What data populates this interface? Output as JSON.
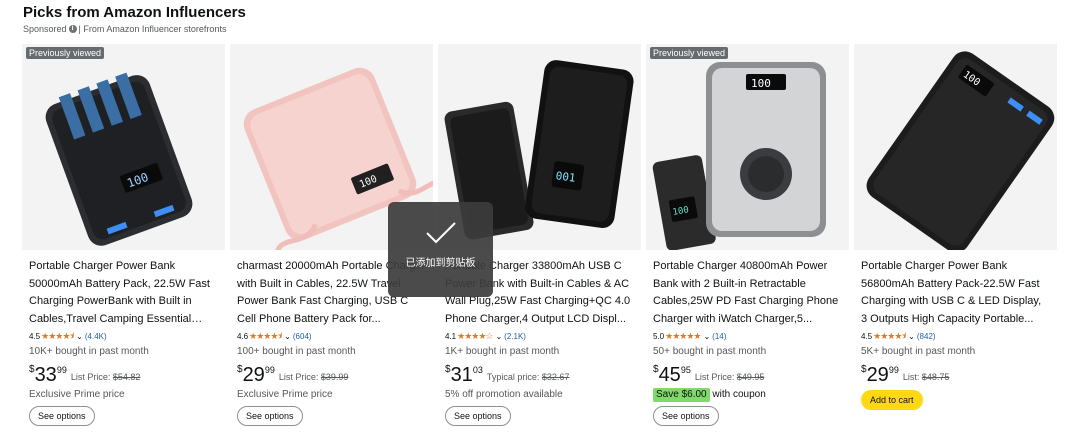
{
  "header": {
    "title": "Picks from Amazon Influencers",
    "sponsored": "Sponsored",
    "info_icon": "i",
    "source": "| From Amazon Influencer storefronts"
  },
  "products": [
    {
      "badge": "Previously viewed",
      "title": "Portable Charger Power Bank 50000mAh Battery Pack, 22.5W Fast Charging PowerBank with Built in Cables,Travel Camping Essential US...",
      "rating": "4.5",
      "stars": "★★★★⯨",
      "reviews": "(4.4K)",
      "bought": "10K+ bought in past month",
      "price_currency": "$",
      "price_whole": "33",
      "price_fraction": "99",
      "list_label": "List Price:",
      "list_price": "$54.82",
      "extra": "Exclusive Prime price",
      "button": "See options",
      "image_type": "black-powerbank-cables"
    },
    {
      "badge": "",
      "title": "charmast 20000mAh Portable Charger with Built in Cables, 22.5W Travel Power Bank Fast Charging, USB C Cell Phone Battery Pack for...",
      "rating": "4.6",
      "stars": "★★★★⯨",
      "reviews": "(604)",
      "bought": "100+ bought in past month",
      "price_currency": "$",
      "price_whole": "29",
      "price_fraction": "99",
      "list_label": "List Price:",
      "list_price": "$39.99",
      "extra": "Exclusive Prime price",
      "button": "See options",
      "image_type": "pink-powerbank"
    },
    {
      "badge": "",
      "title": "Portable Charger 33800mAh USB C Power Bank with Built-in Cables & AC Wall Plug,25W Fast Charging+QC 4.0 Phone Charger,4 Output LCD Displ...",
      "rating": "4.1",
      "stars": "★★★★☆",
      "reviews": "(2.1K)",
      "bought": "1K+ bought in past month",
      "price_currency": "$",
      "price_whole": "31",
      "price_fraction": "03",
      "list_label": "Typical price:",
      "list_price": "$32.67",
      "extra": "5% off promotion available",
      "button": "See options",
      "image_type": "black-powerbank-plug"
    },
    {
      "badge": "Previously viewed",
      "title": "Portable Charger 40800mAh Power Bank with 2 Built-in Retractable Cables,25W PD Fast Charging Phone Charger with iWatch Charger,5...",
      "rating": "5.0",
      "stars": "★★★★★",
      "reviews": "(14)",
      "bought": "50+ bought in past month",
      "price_currency": "$",
      "price_whole": "45",
      "price_fraction": "95",
      "list_label": "List Price:",
      "list_price": "$49.95",
      "save_label": "Save $6.00",
      "coupon_label": "with coupon",
      "button": "See options",
      "image_type": "silver-powerbank-watch"
    },
    {
      "badge": "",
      "title": "Portable Charger Power Bank 56800mAh Battery Pack-22.5W Fast Charging with USB C & LED Display, 3 Outputs High Capacity Portable...",
      "rating": "4.5",
      "stars": "★★★★⯨",
      "reviews": "(842)",
      "bought": "5K+ bought in past month",
      "price_currency": "$",
      "price_whole": "29",
      "price_fraction": "99",
      "list_label": "List:",
      "list_price": "$48.75",
      "button": "Add to cart",
      "image_type": "black-powerbank-display"
    }
  ],
  "toast": {
    "text": "已添加到剪贴板",
    "icon": "checkmark-icon"
  },
  "colors": {
    "star": "#de7921",
    "link": "#2162a1",
    "cart_button": "#ffd814",
    "save_badge": "#7fda69"
  }
}
